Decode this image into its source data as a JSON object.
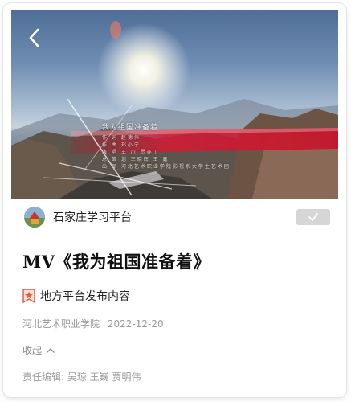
{
  "video": {
    "credits_title": "我为祖国准备着",
    "credits_lines": [
      "作 词 赵德伟",
      "作 曲 郑小宁",
      "演 唱 王 川 贾亦丁",
      "总 策 划 王晓辉 王 鑫",
      "出 品 河北艺术职业学院影视系大学生艺术团"
    ]
  },
  "poster": {
    "name": "石家庄学习平台"
  },
  "article": {
    "title": "MV《我为祖国准备着》",
    "tag": "地方平台发布内容",
    "source": "河北艺术职业学院",
    "date": "2022-12-20",
    "collapse_label": "收起",
    "editors": "责任编辑: 吴琼 王巍 贾明伟"
  },
  "icons": {
    "back": "chevron-left-icon",
    "follow": "check-icon",
    "tag": "star-badge-icon",
    "collapse": "chevron-up-icon"
  },
  "colors": {
    "tag_icon": "#e8573f",
    "follow_bg": "#d6d6d6"
  }
}
